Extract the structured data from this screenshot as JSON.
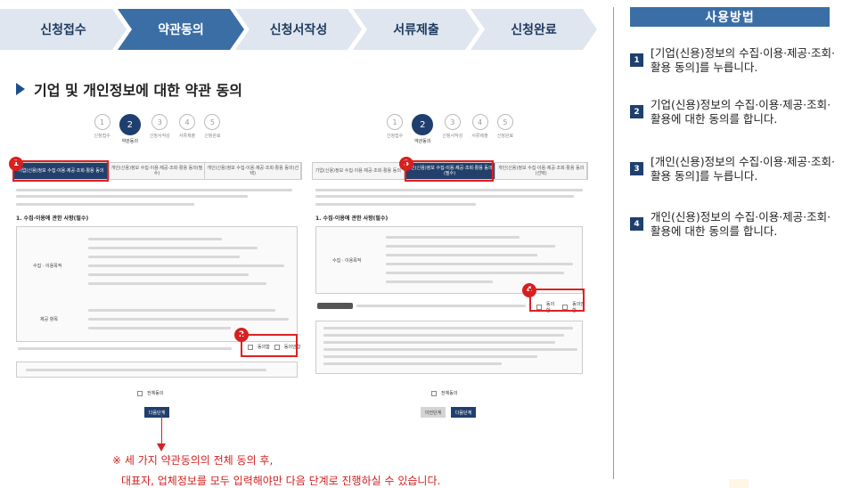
{
  "steps": [
    "신청접수",
    "약관동의",
    "신청서작성",
    "서류제출",
    "신청완료"
  ],
  "section_title": "기업 및 개인정보에 대한 약관 동의",
  "mini": {
    "steps": [
      {
        "num": "1",
        "label": "신청접수"
      },
      {
        "num": "2",
        "label": "약관동의"
      },
      {
        "num": "3",
        "label": "신청서작성"
      },
      {
        "num": "4",
        "label": "서류제출"
      },
      {
        "num": "5",
        "label": "신청완료"
      }
    ],
    "tabs": [
      "기업(신용)정보 수집·이용·제공·조회·활용 동의",
      "개인(신용)정보 수집·이용·제공·조회·활용 동의(필수)",
      "개인(신용)정보 수집·이용·제공·조회·활용 동의(선택)"
    ],
    "section1": "1. 수집·이용에 관한 사항(필수)",
    "purpose_label": "수집 · 이용목적",
    "items_label": "제공 항목",
    "agree": "동의함",
    "disagree": "동의안함",
    "agree_all": "전체동의",
    "prev": "이전단계",
    "next": "다음단계"
  },
  "badges": [
    "1",
    "2",
    "3",
    "4"
  ],
  "note": {
    "line1": "※ 세 가지 약관동의의 전체 동의 후,",
    "line2": "대표자, 업체정보를 모두 입력해야만 다음 단계로 진행하실 수 있습니다."
  },
  "panel": {
    "title": "사용방법",
    "items": [
      {
        "num": "1",
        "text": "[기업(신용)정보의 수집·이용·제공·조회·활용 동의]를 누릅니다."
      },
      {
        "num": "2",
        "text": "기업(신용)정보의 수집·이용·제공·조회·활용에 대한 동의를 합니다."
      },
      {
        "num": "3",
        "text": "[개인(신용)정보의 수집·이용·제공·조회·활용 동의]를 누릅니다."
      },
      {
        "num": "4",
        "text": "개인(신용)정보의 수집·이용·제공·조회·활용에 대한 동의를 합니다."
      }
    ]
  },
  "colors": {
    "accent": "#3b6ea5",
    "dark": "#1f3f6e",
    "alert": "#d42020",
    "step_bg": "#dfe6ef"
  }
}
